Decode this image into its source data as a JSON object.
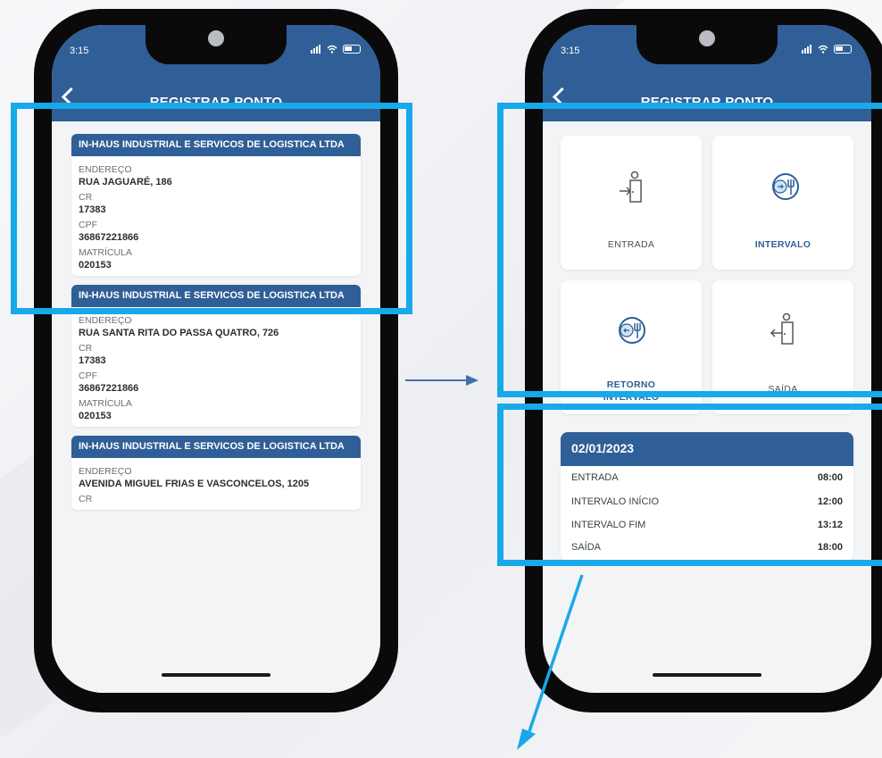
{
  "status": {
    "time": "3:15",
    "signal": "◂◂◂",
    "wifi": "≈"
  },
  "left_screen": {
    "title": "REGISTRAR PONTO",
    "cards": [
      {
        "company": "IN-HAUS INDUSTRIAL E SERVICOS DE LOGISTICA LTDA",
        "endereco_label": "ENDEREÇO",
        "endereco": "RUA JAGUARÉ, 186",
        "cr_label": "CR",
        "cr": "17383",
        "cpf_label": "CPF",
        "cpf": "36867221866",
        "matricula_label": "MATRÍCULA",
        "matricula": "020153"
      },
      {
        "company": "IN-HAUS INDUSTRIAL E SERVICOS DE LOGISTICA LTDA",
        "endereco_label": "ENDEREÇO",
        "endereco": "RUA SANTA RITA DO PASSA QUATRO, 726",
        "cr_label": "CR",
        "cr": "17383",
        "cpf_label": "CPF",
        "cpf": "36867221866",
        "matricula_label": "MATRÍCULA",
        "matricula": "020153"
      },
      {
        "company": "IN-HAUS INDUSTRIAL E SERVICOS DE LOGISTICA LTDA",
        "endereco_label": "ENDEREÇO",
        "endereco": "AVENIDA MIGUEL FRIAS E VASCONCELOS, 1205",
        "cr_label": "CR"
      }
    ]
  },
  "right_screen": {
    "title": "REGISTRAR PONTO",
    "tiles": [
      {
        "label": "ENTRADA",
        "icon": "entrance-door-icon"
      },
      {
        "label": "INTERVALO",
        "icon": "meal-break-icon"
      },
      {
        "label": "RETORNO INTERVALO",
        "icon": "return-break-icon"
      },
      {
        "label": "SAÍDA",
        "icon": "exit-door-icon"
      }
    ],
    "summary": {
      "date": "02/01/2023",
      "rows": [
        {
          "label": "ENTRADA",
          "time": "08:00"
        },
        {
          "label": "INTERVALO INÍCIO",
          "time": "12:00"
        },
        {
          "label": "INTERVALO FIM",
          "time": "13:12"
        },
        {
          "label": "SAÍDA",
          "time": "18:00"
        }
      ]
    }
  },
  "colors": {
    "brand": "#2f5f96",
    "highlight": "#17a9ea",
    "arrow": "#3f6fb0"
  }
}
